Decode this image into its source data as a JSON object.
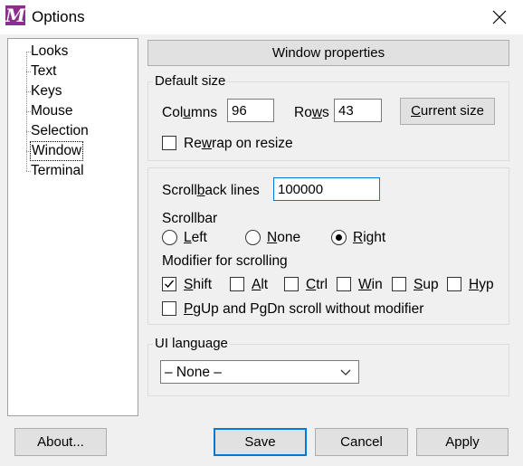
{
  "window": {
    "title": "Options",
    "icon": "app-icon"
  },
  "sidebar": {
    "items": [
      {
        "label": "Looks"
      },
      {
        "label": "Text"
      },
      {
        "label": "Keys"
      },
      {
        "label": "Mouse"
      },
      {
        "label": "Selection"
      },
      {
        "label": "Window",
        "selected": true
      },
      {
        "label": "Terminal"
      }
    ]
  },
  "header": {
    "label": "Window properties"
  },
  "default_size": {
    "title": "Default size",
    "columns_label_pre": "Col",
    "columns_label_u": "u",
    "columns_label_post": "mns",
    "columns_value": "96",
    "rows_label_pre": "Ro",
    "rows_label_u": "w",
    "rows_label_post": "s",
    "rows_value": "43",
    "current_size_pre": "",
    "current_size_u": "C",
    "current_size_post": "urrent size",
    "rewrap_pre": "Re",
    "rewrap_u": "w",
    "rewrap_post": "rap on resize",
    "rewrap_checked": false
  },
  "scroll": {
    "scrollback_pre": "Scroll",
    "scrollback_u": "b",
    "scrollback_post": "ack lines",
    "scrollback_value": "100000",
    "scrollbar_title": "Scrollbar",
    "radio_left_u": "L",
    "radio_left_post": "eft",
    "radio_none_u": "N",
    "radio_none_post": "one",
    "radio_right_u": "R",
    "radio_right_post": "ight",
    "scrollbar_selected": "Right",
    "modifier_title": "Modifier for scrolling",
    "mods": [
      {
        "u": "S",
        "post": "hift",
        "checked": true
      },
      {
        "u": "A",
        "post": "lt",
        "checked": false
      },
      {
        "u": "C",
        "post": "trl",
        "checked": false
      },
      {
        "u": "W",
        "post": "in",
        "checked": false
      },
      {
        "u": "S",
        "post": "up",
        "checked": false
      },
      {
        "u": "H",
        "post": "yp",
        "checked": false
      }
    ],
    "pgup_u": "P",
    "pgup_post": "gUp and PgDn scroll without modifier",
    "pgup_checked": false
  },
  "ui_language": {
    "title": "UI language",
    "selected": "– None –"
  },
  "buttons": {
    "about": "About...",
    "save": "Save",
    "cancel": "Cancel",
    "apply": "Apply"
  }
}
